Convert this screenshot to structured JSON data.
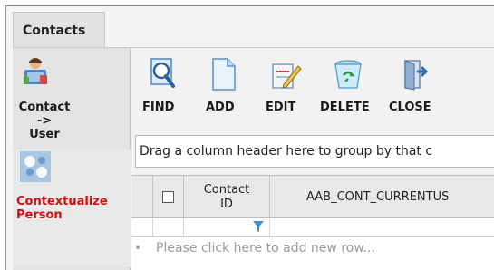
{
  "tabs": [
    {
      "label": "Contacts"
    }
  ],
  "sidebar": {
    "items": [
      {
        "label": "Contact\n->\nUser",
        "icon": "contact-user-icon",
        "color": "#1a1a1a"
      },
      {
        "label": "Contextualize\nPerson",
        "icon": "contextualize-icon",
        "color": "#cc1010"
      }
    ]
  },
  "toolbar": {
    "buttons": [
      {
        "label": "FIND",
        "icon": "magnifier-icon"
      },
      {
        "label": "ADD",
        "icon": "blank-page-icon"
      },
      {
        "label": "EDIT",
        "icon": "edit-pencil-icon"
      },
      {
        "label": "DELETE",
        "icon": "recycle-bin-icon"
      },
      {
        "label": "CLOSE",
        "icon": "door-exit-icon"
      }
    ]
  },
  "grid": {
    "group_hint": "Drag a column header here to group by that c",
    "columns": [
      {
        "label": "Contact\nID"
      },
      {
        "label": "AAB_CONT_CURRENTUS"
      }
    ],
    "new_row_marker": "*",
    "new_row_hint": "Please click here to add new row..."
  },
  "colors": {
    "accent_red": "#cc1010",
    "filter_icon": "#3a8fd6"
  }
}
